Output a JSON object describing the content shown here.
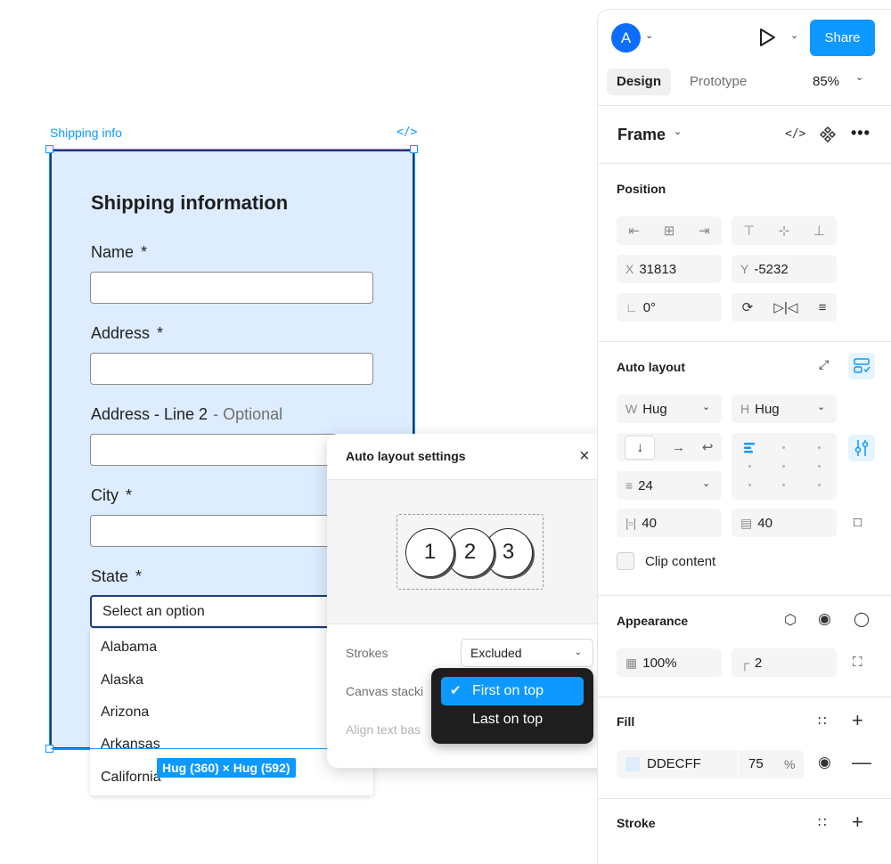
{
  "canvas": {
    "frame_label": "Shipping info",
    "frame_code_icon": "code-icon",
    "form_title": "Shipping information",
    "fields": [
      {
        "label": "Name",
        "required": "*"
      },
      {
        "label": "Address",
        "required": "*"
      },
      {
        "label": "Address - Line 2",
        "optional": "- Optional"
      },
      {
        "label": "City",
        "required": "*"
      },
      {
        "label": "State",
        "required": "*"
      }
    ],
    "select_placeholder": "Select an option",
    "options": [
      "Alabama",
      "Alaska",
      "Arizona",
      "Arkansas",
      "California"
    ],
    "size_badge": "Hug (360) × Hug (592)"
  },
  "popup": {
    "title": "Auto layout settings",
    "close_icon": "×",
    "circles": [
      "1",
      "2",
      "3"
    ],
    "strokes_label": "Strokes",
    "strokes_value": "Excluded",
    "canvas_stacking_label": "Canvas stacki",
    "align_text_label": "Align text bas",
    "stacking_menu": {
      "items": [
        "First on top",
        "Last on top"
      ],
      "selected": "First on top",
      "check": "✔"
    }
  },
  "panel": {
    "avatar_letter": "A",
    "share_label": "Share",
    "tabs": [
      "Design",
      "Prototype"
    ],
    "zoom": "85%",
    "frame_label": "Frame",
    "position": {
      "title": "Position",
      "x_label": "X",
      "x": "31813",
      "y_label": "Y",
      "y": "-5232",
      "rotation": "0°"
    },
    "auto_layout": {
      "title": "Auto layout",
      "w_label": "W",
      "w_value": "Hug",
      "h_label": "H",
      "h_value": "Hug",
      "gap": "24",
      "padding_h": "40",
      "padding_v": "40",
      "clip_label": "Clip content"
    },
    "appearance": {
      "title": "Appearance",
      "opacity": "100%",
      "radius": "2"
    },
    "fill": {
      "title": "Fill",
      "hex": "DDECFF",
      "opacity": "75",
      "percent": "%"
    },
    "stroke": {
      "title": "Stroke"
    }
  },
  "colors": {
    "accent": "#0d99ff",
    "frame_fill": "#ddecff",
    "menu_bg": "#1e1e1e"
  }
}
